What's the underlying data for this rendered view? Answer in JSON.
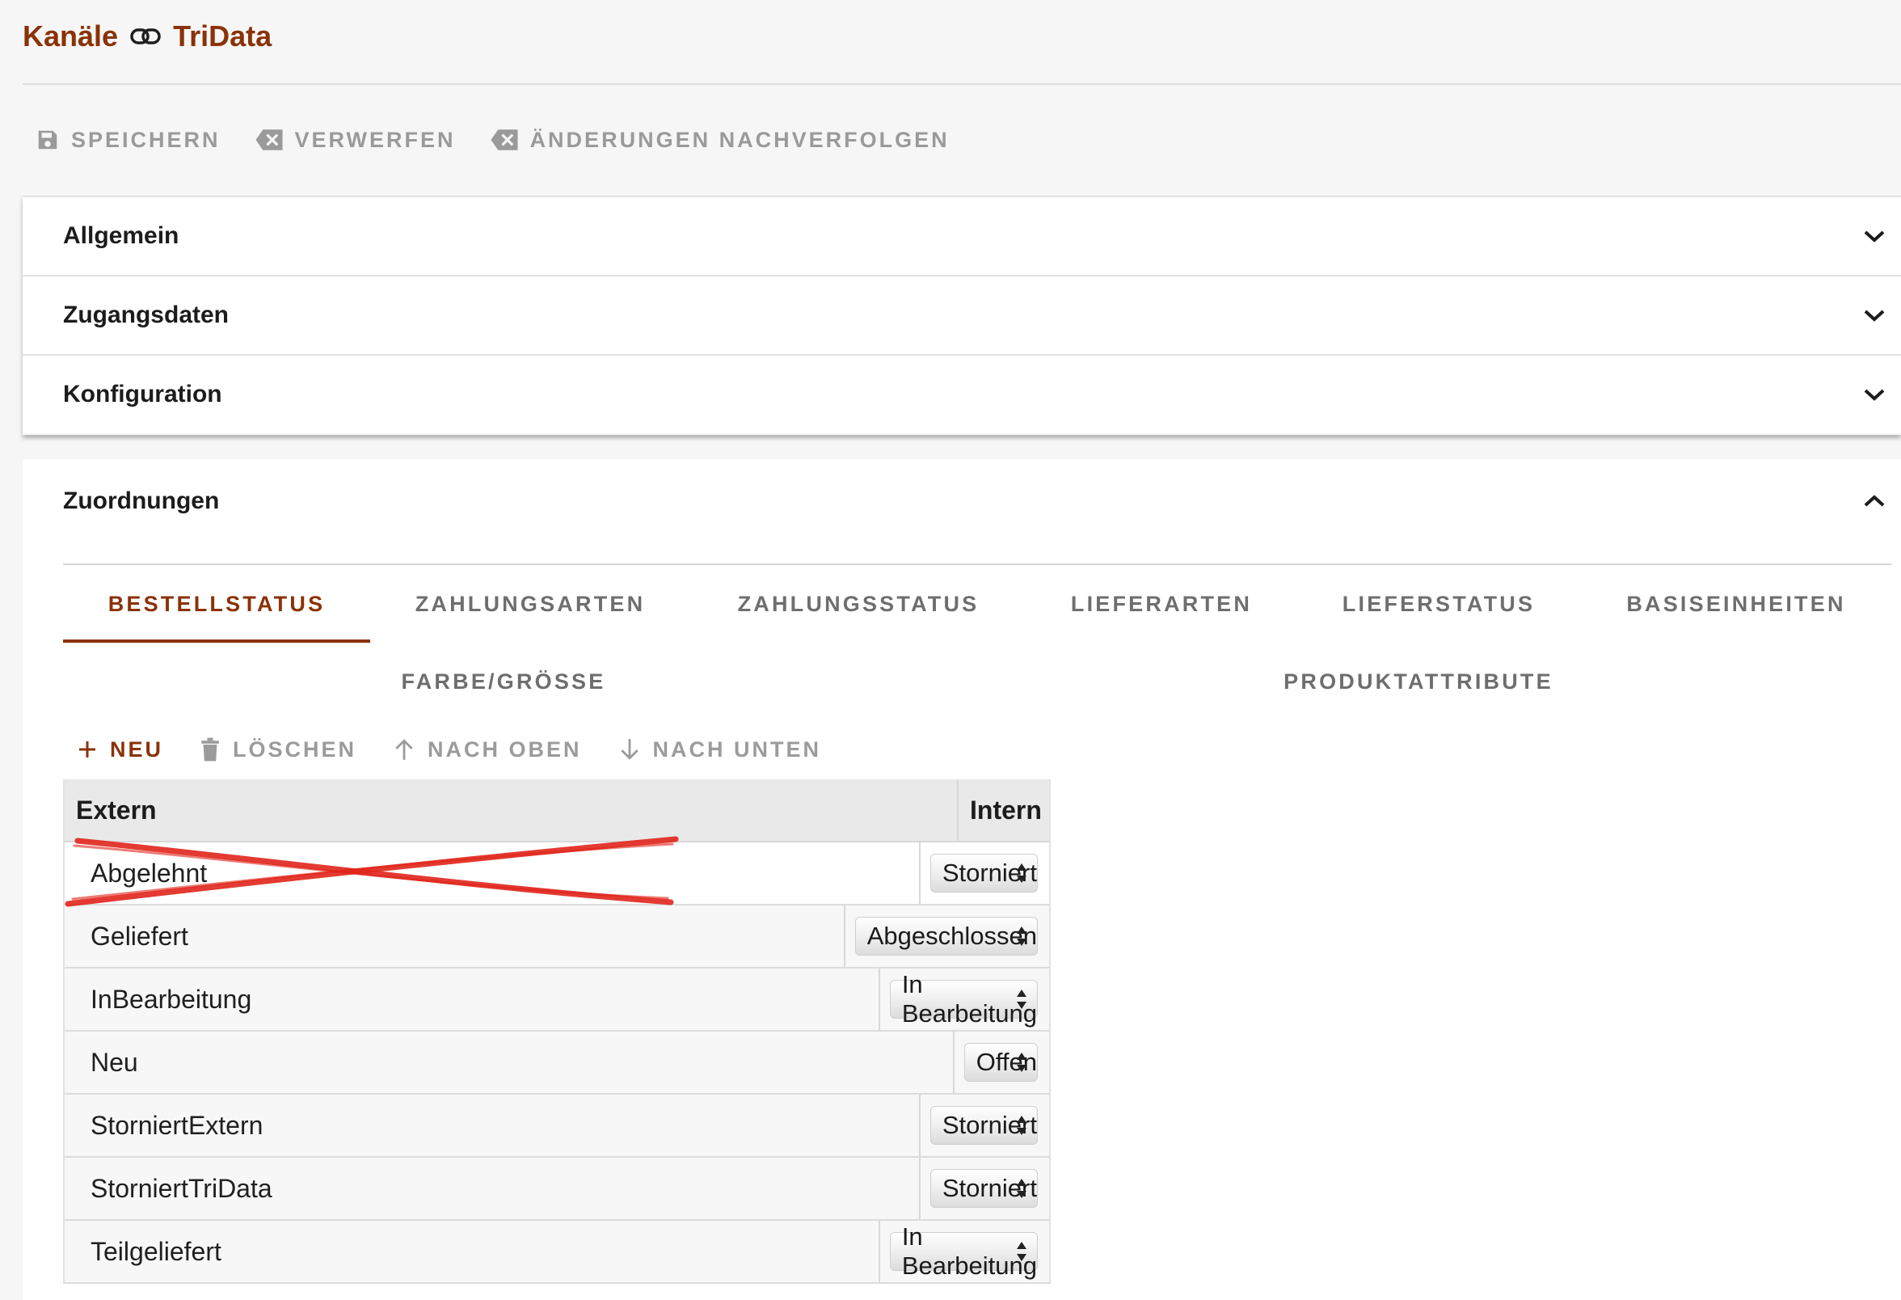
{
  "breadcrumb": {
    "parent": "Kanäle",
    "current": "TriData",
    "separator_icon": "link-icon"
  },
  "toolbar": {
    "save": "SPEICHERN",
    "discard": "VERWERFEN",
    "track": "ÄNDERUNGEN NACHVERFOLGEN"
  },
  "panels": {
    "general": "Allgemein",
    "credentials": "Zugangsdaten",
    "configuration": "Konfiguration",
    "mappings": "Zuordnungen"
  },
  "tabs": {
    "order_status": "BESTELLSTATUS",
    "payment_methods": "ZAHLUNGSARTEN",
    "payment_status": "ZAHLUNGSSTATUS",
    "delivery_methods": "LIEFERARTEN",
    "delivery_status": "LIEFERSTATUS",
    "base_units": "BASISEINHEITEN",
    "color_size": "FARBE/GRÖSSE",
    "product_attributes": "PRODUKTATTRIBUTE",
    "active": "BESTELLSTATUS"
  },
  "grid_toolbar": {
    "new": "NEU",
    "delete": "LÖSCHEN",
    "up": "NACH OBEN",
    "down": "NACH UNTEN"
  },
  "table": {
    "col_extern": "Extern",
    "col_intern": "Intern",
    "rows": [
      {
        "extern": "Abgelehnt",
        "intern": "Storniert",
        "crossed_out": true
      },
      {
        "extern": "Geliefert",
        "intern": "Abgeschlossen"
      },
      {
        "extern": "InBearbeitung",
        "intern": "In Bearbeitung"
      },
      {
        "extern": "Neu",
        "intern": "Offen"
      },
      {
        "extern": "StorniertExtern",
        "intern": "Storniert"
      },
      {
        "extern": "StorniertTriData",
        "intern": "Storniert"
      },
      {
        "extern": "Teilgeliefert",
        "intern": "In Bearbeitung"
      }
    ]
  },
  "colors": {
    "accent": "#8a3208",
    "annotation_red": "#e0251b"
  }
}
